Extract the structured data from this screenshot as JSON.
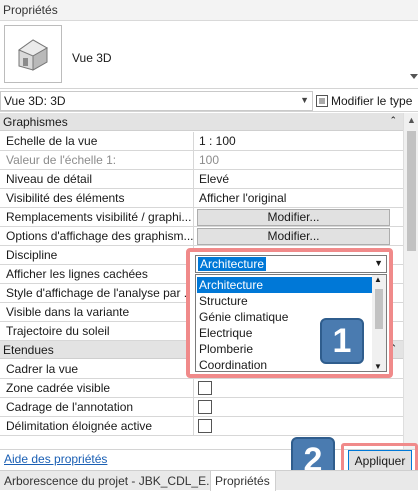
{
  "panel": {
    "title": "Propriétés"
  },
  "type_selector": {
    "name": "Vue 3D",
    "icon": "house-3d-icon"
  },
  "instance_selector": {
    "value": "Vue 3D: 3D",
    "edit_type_label": "Modifier le type"
  },
  "sections": {
    "graphics": "Graphismes",
    "extents": "Etendues"
  },
  "properties": [
    {
      "name": "Echelle de la vue",
      "value": "1 : 100"
    },
    {
      "name": "Valeur de l'échelle    1:",
      "value": "100"
    },
    {
      "name": "Niveau de détail",
      "value": "Elevé"
    },
    {
      "name": "Visibilité des éléments",
      "value": "Afficher l'original"
    },
    {
      "name": "Remplacements visibilité / graphi...",
      "value": "Modifier..."
    },
    {
      "name": "Options d'affichage des graphism...",
      "value": "Modifier..."
    },
    {
      "name": "Discipline",
      "value": "Architecture"
    },
    {
      "name": "Afficher les lignes cachées",
      "value": ""
    },
    {
      "name": "Style d'affichage de l'analyse par ...",
      "value": ""
    },
    {
      "name": "Visible dans la variante",
      "value": ""
    },
    {
      "name": "Trajectoire du soleil",
      "value": ""
    }
  ],
  "extents": [
    {
      "name": "Cadrer la vue"
    },
    {
      "name": "Zone cadrée visible"
    },
    {
      "name": "Cadrage de l'annotation"
    },
    {
      "name": "Délimitation éloignée active"
    }
  ],
  "discipline_dropdown": {
    "current": "Architecture",
    "options": [
      "Architecture",
      "Structure",
      "Génie climatique",
      "Electrique",
      "Plomberie",
      "Coordination"
    ]
  },
  "footer": {
    "help_link": "Aide des propriétés",
    "apply_label": "Appliquer"
  },
  "tabs": [
    "Arborescence du projet - JBK_CDL_E...",
    "Propriétés"
  ],
  "callouts": {
    "first": "1",
    "second": "2"
  },
  "colors": {
    "highlight_border": "#f08a8a",
    "badge": "#4a7bb0",
    "selection": "#0078d7"
  }
}
